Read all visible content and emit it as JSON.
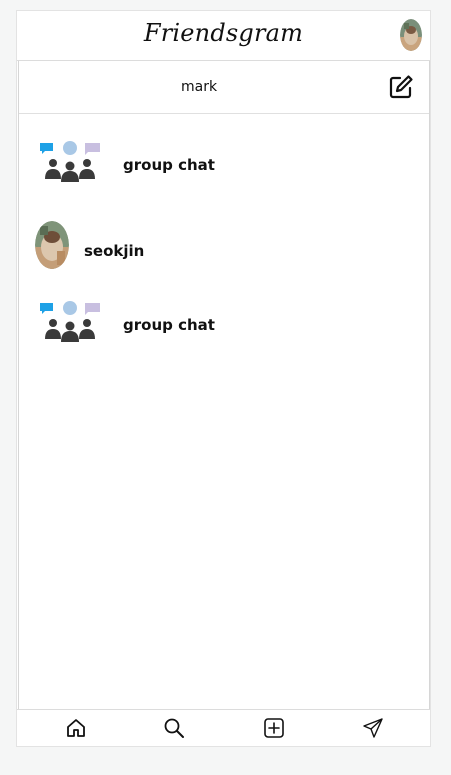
{
  "header": {
    "brand": "Friendsgram"
  },
  "messages": {
    "current_user": "mark",
    "conversations": [
      {
        "name": "group chat",
        "type": "group",
        "icon": "group-chat-icon"
      },
      {
        "name": "seokjin",
        "type": "user",
        "icon": "avatar"
      },
      {
        "name": "group chat",
        "type": "group",
        "icon": "group-chat-icon"
      }
    ]
  },
  "nav": {
    "items": [
      {
        "icon": "home-icon"
      },
      {
        "icon": "search-icon"
      },
      {
        "icon": "add-post-icon"
      },
      {
        "icon": "send-icon"
      }
    ]
  },
  "colors": {
    "bubble_blue": "#1ea1e6",
    "bubble_lightblue": "#a9c8e6",
    "bubble_lavender": "#c8bfe0",
    "people": "#3a3a3a"
  }
}
